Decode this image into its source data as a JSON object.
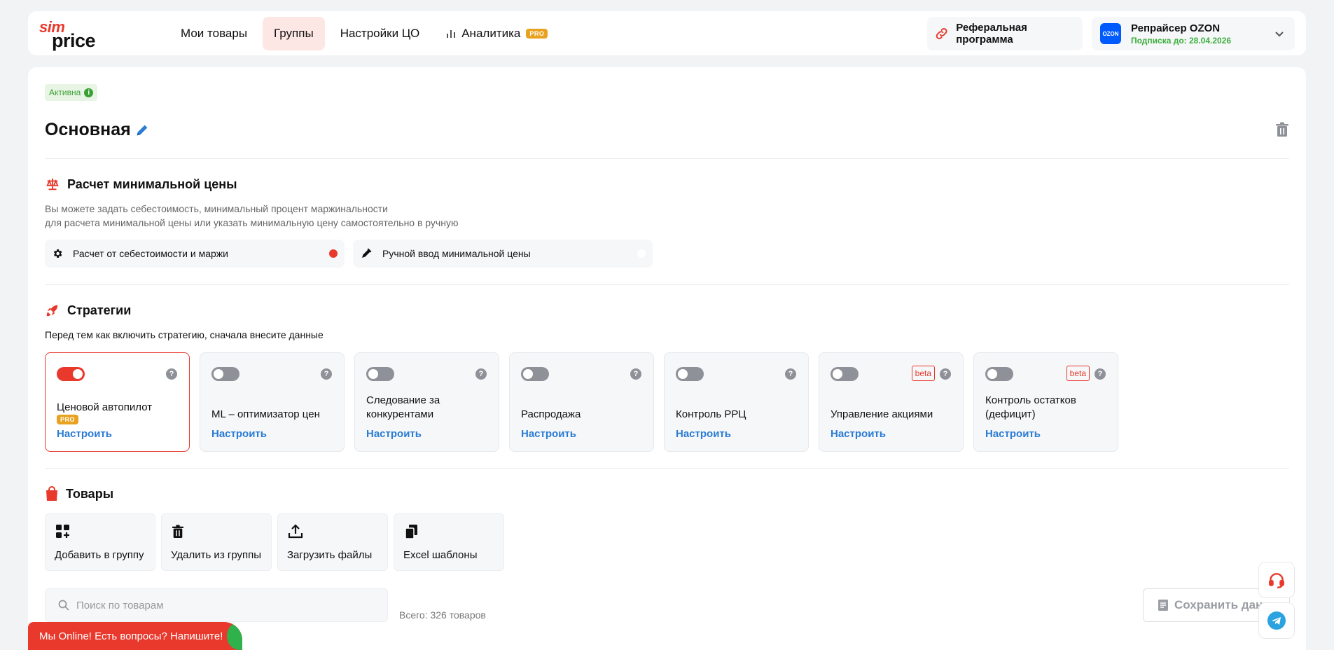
{
  "header": {
    "logo_top": "sim",
    "logo_bottom": "price",
    "nav": [
      {
        "label": "Мои товары"
      },
      {
        "label": "Группы"
      },
      {
        "label": "Настройки ЦО"
      },
      {
        "label": "Аналитика",
        "badge": "PRO"
      }
    ],
    "referral": "Реферальная программа",
    "account": {
      "logo": "OZON",
      "name": "Репрайсер OZON",
      "subscription": "Подписка до: 28.04.2026"
    }
  },
  "group": {
    "status": "Активна",
    "status_info": "i",
    "title": "Основная"
  },
  "min_price": {
    "heading": "Расчет минимальной цены",
    "desc_line1": "Вы можете задать себестоимость, минимальный процент маржинальности",
    "desc_line2": "для расчета минимальной цены или указать минимальную цену самостоятельно в ручную",
    "option_cost": "Расчет от себестоимости и маржи",
    "option_manual": "Ручной ввод минимальной цены"
  },
  "strategies": {
    "heading": "Стратегии",
    "desc": "Перед тем как включить стратегию, сначала внесите данные",
    "help": "?",
    "configure": "Настроить",
    "items": [
      {
        "name": "Ценовой автопилот",
        "pro": "PRO",
        "enabled": true
      },
      {
        "name": "ML – оптимизатор цен",
        "enabled": false
      },
      {
        "name": "Следование за конкурентами",
        "enabled": false
      },
      {
        "name": "Распродажа",
        "enabled": false
      },
      {
        "name": "Контроль РРЦ",
        "enabled": false
      },
      {
        "name": "Управление акциями",
        "beta": "beta",
        "enabled": false
      },
      {
        "name": "Контроль остатков (дефицит)",
        "beta": "beta",
        "enabled": false
      }
    ]
  },
  "products": {
    "heading": "Товары",
    "actions": [
      {
        "label": "Добавить в группу"
      },
      {
        "label": "Удалить из группы"
      },
      {
        "label": "Загрузить файлы"
      },
      {
        "label": "Excel шаблоны"
      }
    ],
    "search_placeholder": "Поиск по товарам",
    "total": "Всего: 326 товаров",
    "save": "Сохранить данные"
  },
  "chat_banner": "Мы Online! Есть вопросы? Напишите!",
  "colors": {
    "accent": "#e8392c",
    "link": "#2a7cd4",
    "success": "#3aa035",
    "pro": "#e9a21f"
  }
}
